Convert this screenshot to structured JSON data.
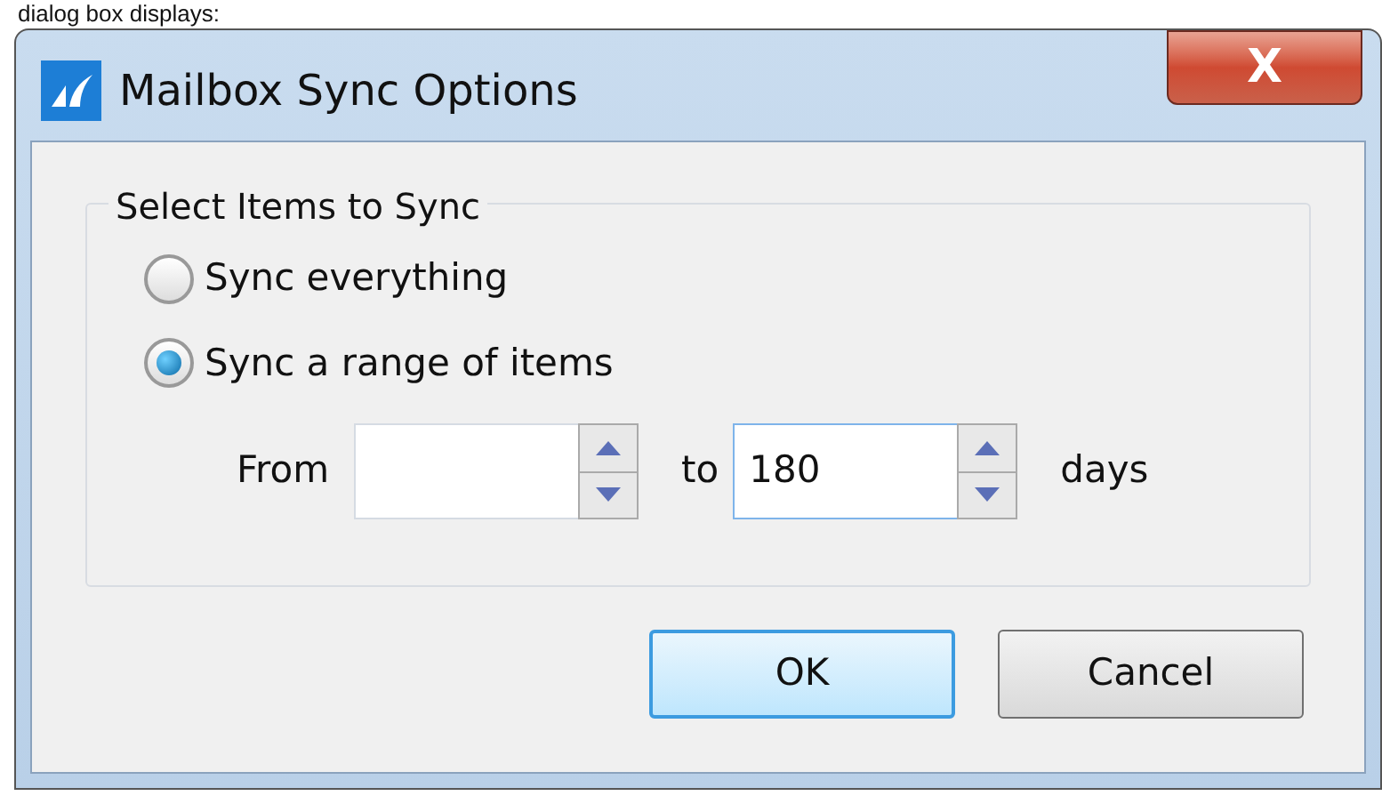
{
  "caption": "dialog box displays:",
  "window": {
    "title": "Mailbox Sync Options",
    "close": "X"
  },
  "group": {
    "title": "Select Items to Sync",
    "options": [
      {
        "label": "Sync everything",
        "selected": false
      },
      {
        "label": "Sync a range of items",
        "selected": true
      }
    ]
  },
  "range": {
    "from_label": "From",
    "to_label": "to",
    "to_value": "180",
    "unit": "days"
  },
  "buttons": [
    {
      "label": "OK",
      "default": true
    },
    {
      "label": "Cancel",
      "default": false
    }
  ]
}
